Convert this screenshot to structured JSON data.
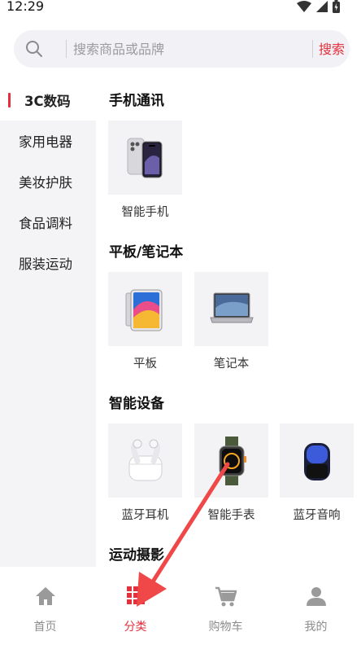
{
  "status": {
    "time": "12:29"
  },
  "search": {
    "placeholder": "搜索商品或品牌",
    "button_label": "搜索"
  },
  "sidebar": {
    "items": [
      {
        "label": "3C数码",
        "active": true
      },
      {
        "label": "家用电器"
      },
      {
        "label": "美妆护肤"
      },
      {
        "label": "食品调料"
      },
      {
        "label": "服装运动"
      }
    ]
  },
  "sections": [
    {
      "title": "手机通讯",
      "items": [
        {
          "label": "智能手机",
          "icon": "smartphone-icon"
        }
      ]
    },
    {
      "title": "平板/笔记本",
      "items": [
        {
          "label": "平板",
          "icon": "tablet-icon"
        },
        {
          "label": "笔记本",
          "icon": "laptop-icon"
        }
      ]
    },
    {
      "title": "智能设备",
      "items": [
        {
          "label": "蓝牙耳机",
          "icon": "earbuds-icon"
        },
        {
          "label": "智能手表",
          "icon": "smartwatch-icon"
        },
        {
          "label": "蓝牙音响",
          "icon": "speaker-icon"
        }
      ]
    },
    {
      "title": "运动摄影",
      "items": []
    }
  ],
  "tabbar": {
    "items": [
      {
        "label": "首页",
        "icon": "home-icon"
      },
      {
        "label": "分类",
        "icon": "grid-icon",
        "active": true
      },
      {
        "label": "购物车",
        "icon": "cart-icon"
      },
      {
        "label": "我的",
        "icon": "person-icon"
      }
    ]
  },
  "colors": {
    "accent": "#e3303c",
    "annotation_arrow": "#f04848",
    "sidebar_bg": "#f4f4f7",
    "search_bg": "#f2f2f6"
  }
}
